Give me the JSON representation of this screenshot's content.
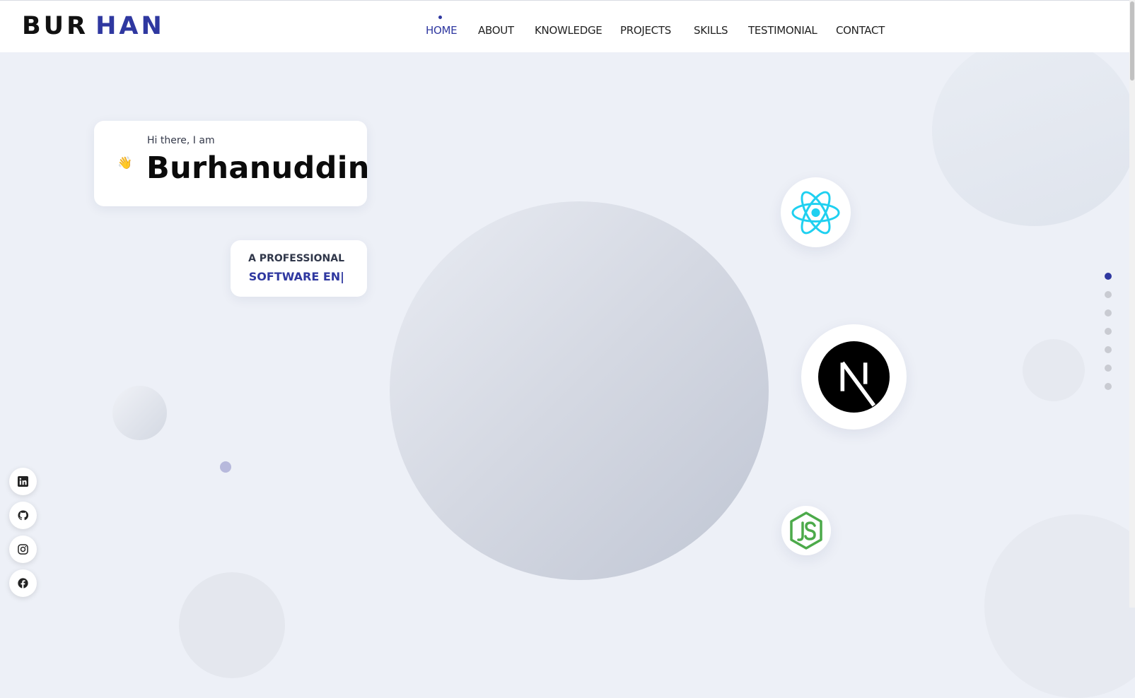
{
  "brand": {
    "part1": "BUR",
    "part2": "HAN"
  },
  "nav": {
    "items": [
      {
        "label": "HOME",
        "active": true
      },
      {
        "label": "ABOUT"
      },
      {
        "label": "KNOWLEDGE"
      },
      {
        "label": "PROJECTS"
      },
      {
        "label": "SKILLS"
      },
      {
        "label": "TESTIMONIAL"
      },
      {
        "label": "CONTACT"
      }
    ]
  },
  "hero": {
    "greeting": "Hi there, I am",
    "wave": "👋",
    "name": "Burhanuddin",
    "role_line1": "A PROFESSIONAL",
    "role_typed": "SOFTWARE EN|"
  },
  "tech_icons": [
    "react-icon",
    "nextjs-icon",
    "nodejs-icon"
  ],
  "section_dots": {
    "count": 7,
    "active_index": 0
  },
  "social_links": [
    "linkedin-icon",
    "github-icon",
    "instagram-icon",
    "facebook-icon"
  ],
  "colors": {
    "accent": "#2f38a0",
    "background": "#edf0f7",
    "react": "#1fd0f0",
    "node": "#4caa4a"
  }
}
